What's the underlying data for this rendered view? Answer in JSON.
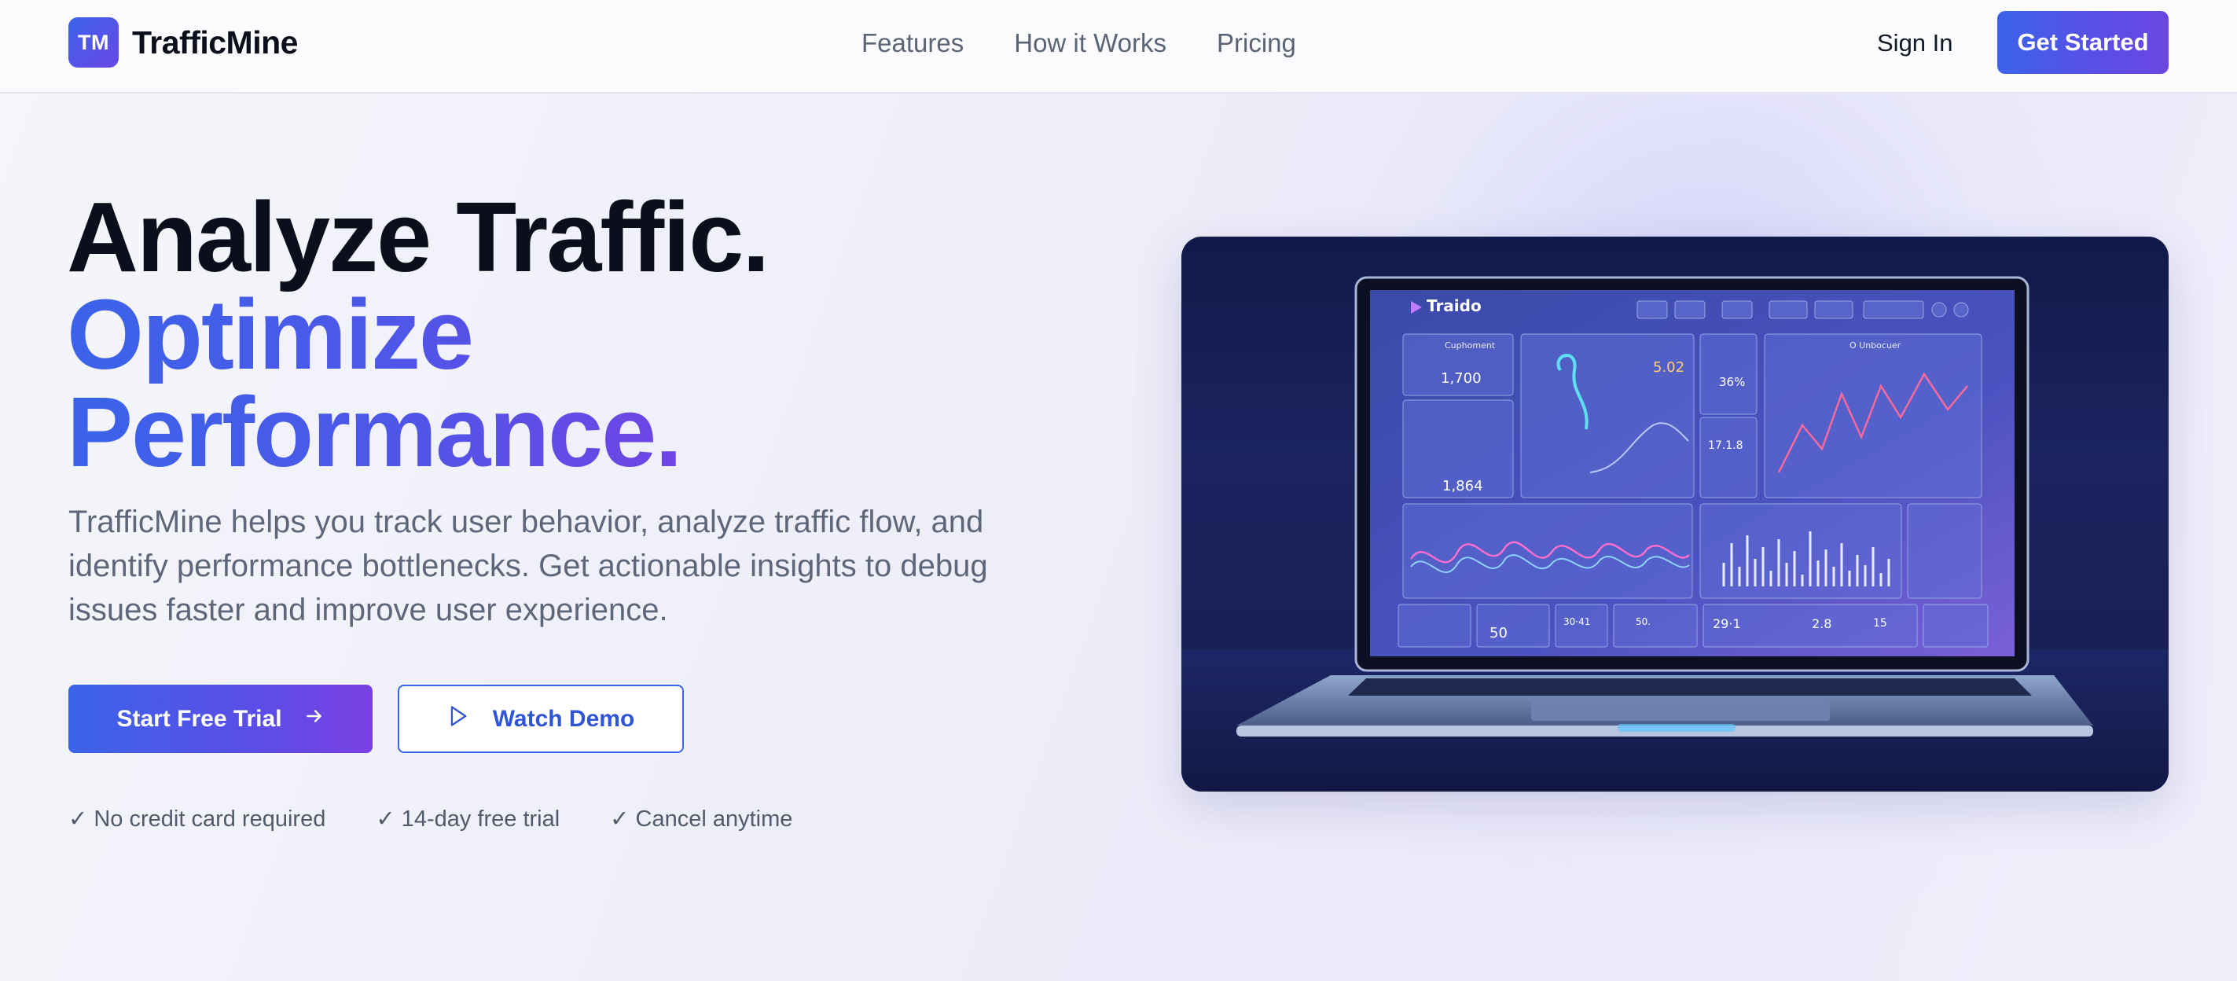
{
  "nav": {
    "logo_mark": "TM",
    "brand": "TrafficMine",
    "links": [
      "Features",
      "How it Works",
      "Pricing"
    ],
    "sign_in": "Sign In",
    "get_started": "Get Started"
  },
  "hero": {
    "title_line1": "Analyze Traffic.",
    "title_line2": "Optimize",
    "title_line3": "Performance.",
    "subtitle": "TrafficMine helps you track user behavior, analyze traffic flow, and identify performance bottlenecks. Get actionable insights to debug issues faster and improve user experience.",
    "primary_cta": "Start Free Trial",
    "secondary_cta": "Watch Demo",
    "checks": [
      "✓ No credit card required",
      "✓ 14-day free trial",
      "✓ Cancel anytime"
    ]
  },
  "laptop_screen": {
    "app_name": "Traido",
    "panel_1_title": "Cuphoment",
    "panel_1_value": "1,700",
    "panel_2_value": "1,864",
    "panel_3_value": "5.02",
    "panel_4_value": "36%",
    "panel_5_value": "17.1.8",
    "panel_6_title": "O Unbocuer",
    "footer_values": [
      "50",
      "30·41",
      "50.",
      "29·1",
      "2.8",
      "15"
    ]
  },
  "colors": {
    "brand_blue": "#3b63ea",
    "brand_purple": "#7a40e2",
    "text_dark": "#0b0f1c",
    "text_muted": "#5d6779"
  },
  "icons": {
    "primary_cta": "arrow-right-icon",
    "secondary_cta": "play-icon"
  }
}
